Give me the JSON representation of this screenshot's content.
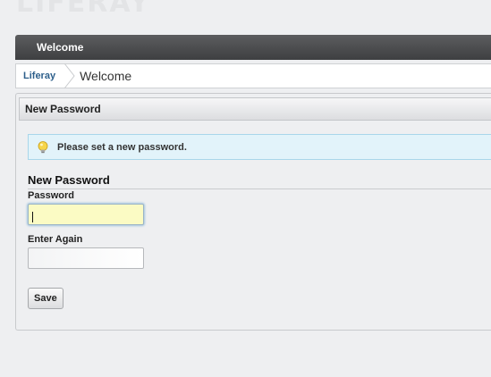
{
  "logo": {
    "text": "LIFERAY"
  },
  "portlet": {
    "title": "Welcome"
  },
  "breadcrumb": {
    "items": [
      {
        "label": "Liferay"
      },
      {
        "label": "Welcome"
      }
    ]
  },
  "section": {
    "title": "New Password"
  },
  "info": {
    "icon": "lightbulb-icon",
    "message": "Please set a new password."
  },
  "form": {
    "fieldset_title": "New Password",
    "password_label": "Password",
    "password_value": "",
    "confirm_label": "Enter Again",
    "confirm_value": "",
    "save_label": "Save"
  },
  "colors": {
    "portlet_bar": "#4a4b4d",
    "breadcrumb_link": "#2d5f8b",
    "info_bg": "#e2f3fa",
    "info_border": "#a9d6ea",
    "focused_input_bg": "#fbfbc4"
  }
}
